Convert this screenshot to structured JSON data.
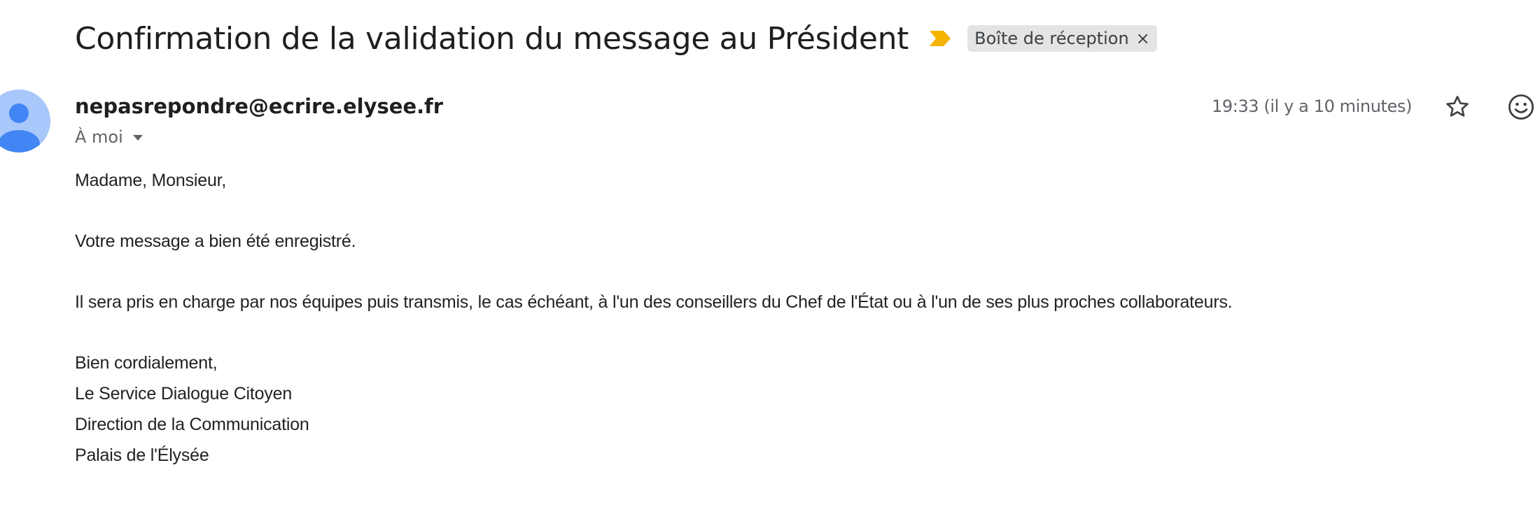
{
  "email": {
    "subject": "Confirmation de la validation du message au Président",
    "label": "Boîte de réception",
    "label_close": "×",
    "sender": "nepasrepondre@ecrire.elysee.fr",
    "recipient": "À moi",
    "timestamp": "19:33 (il y a 10 minutes)",
    "body": {
      "greeting": "Madame, Monsieur,",
      "line1": "Votre message a bien été enregistré.",
      "line2": "Il sera pris en charge par nos équipes puis transmis, le cas échéant, à l'un des conseillers du Chef de l'État ou à l'un de ses plus proches collaborateurs.",
      "signature": [
        "Bien cordialement,",
        "Le Service Dialogue Citoyen",
        "Direction de la Communication",
        "Palais de l'Élysée"
      ]
    }
  },
  "icons": {
    "importance": "importance-marker-icon",
    "avatar": "person-icon",
    "star": "star-icon",
    "emoji": "emoji-icon",
    "recipient_dropdown": "caret-down-icon"
  },
  "colors": {
    "importance": "#f4b400",
    "avatar_bg": "#a8c7fa",
    "avatar_fg": "#4285f4",
    "label_bg": "#e4e4e4"
  }
}
